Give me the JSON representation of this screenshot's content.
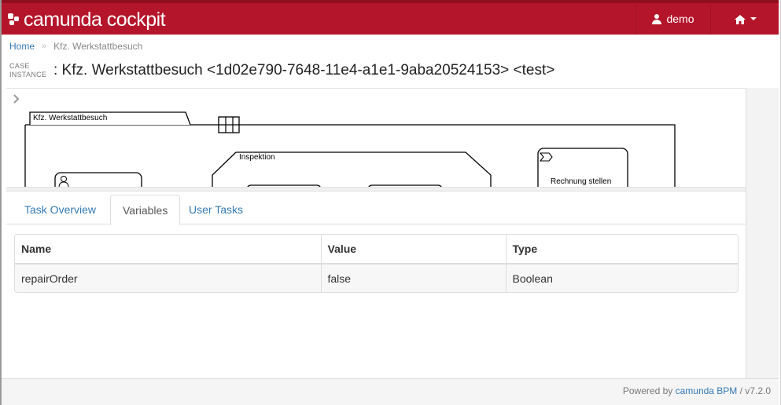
{
  "header": {
    "brand": "camunda cockpit",
    "user": "demo"
  },
  "breadcrumb": {
    "home": "Home",
    "separator": "»",
    "current": "Kfz. Werkstattbesuch"
  },
  "page": {
    "kind_line1": "CASE",
    "kind_line2": "INSTANCE",
    "title": ": Kfz. Werkstattbesuch <1d02e790-7648-11e4-a1e1-9aba20524153> <test>"
  },
  "diagram": {
    "case_plan": "Kfz. Werkstattbesuch",
    "stage": "Inspektion",
    "task": "Rechnung stellen"
  },
  "tabs": [
    {
      "label": "Task Overview"
    },
    {
      "label": "Variables",
      "active": true
    },
    {
      "label": "User Tasks"
    }
  ],
  "variables_table": {
    "headers": [
      "Name",
      "Value",
      "Type"
    ],
    "rows": [
      [
        "repairOrder",
        "false",
        "Boolean"
      ]
    ]
  },
  "footer": {
    "powered_by": "Powered by",
    "link": "camunda BPM",
    "version": "/ v7.2.0"
  },
  "colors": {
    "brand": "#b5152b",
    "link": "#337ab7"
  }
}
